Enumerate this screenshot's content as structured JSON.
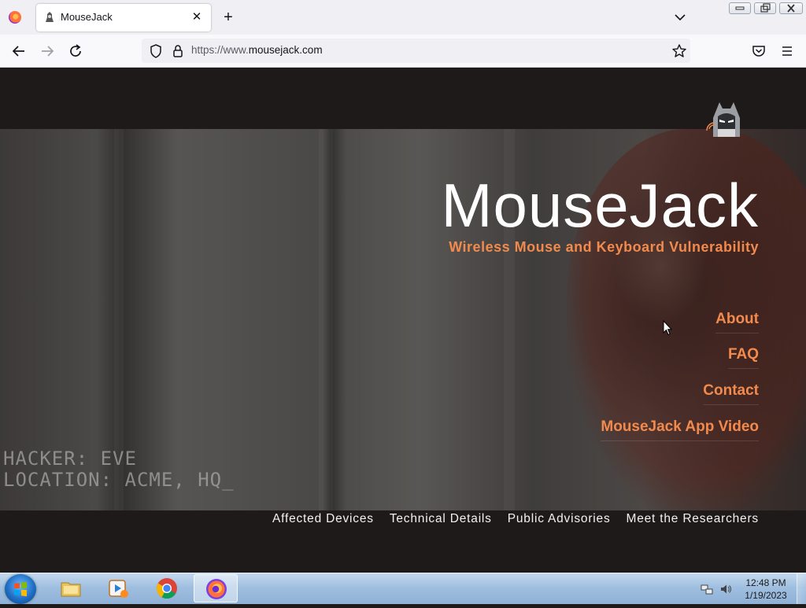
{
  "browser": {
    "tab_title": "MouseJack",
    "url_prefix": "https://www.",
    "url_domain": "mousejack.com"
  },
  "site": {
    "title": "MouseJack",
    "subtitle": "Wireless Mouse and Keyboard Vulnerability",
    "nav": [
      "About",
      "FAQ",
      "Contact",
      "MouseJack App Video"
    ],
    "footer_nav": [
      "Affected Devices",
      "Technical Details",
      "Public Advisories",
      "Meet the Researchers"
    ],
    "video_overlay": [
      "HACKER: EVE",
      "LOCATION: ACME, HQ_"
    ],
    "accent_color": "#f28a4d"
  },
  "taskbar": {
    "apps": [
      "windows-explorer",
      "media-player",
      "chrome",
      "firefox"
    ],
    "clock_time": "12:48 PM",
    "clock_date": "1/19/2023"
  }
}
